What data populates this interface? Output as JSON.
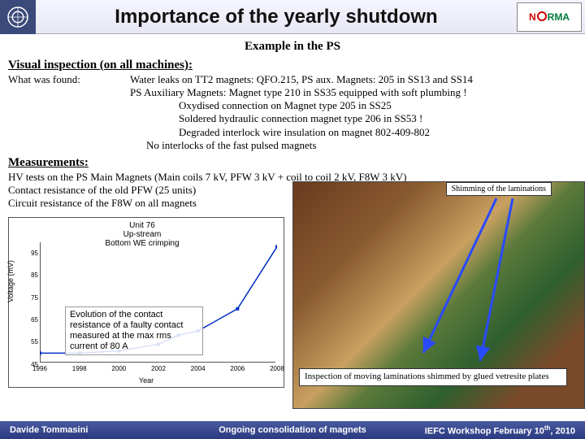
{
  "header": {
    "title": "Importance of the yearly shutdown",
    "right_logo_red": "N",
    "right_logo_green": "RMA"
  },
  "subtitle": "Example in the PS",
  "visual": {
    "heading": "Visual inspection (on all machines):",
    "found_label": "What was found:",
    "lines": [
      "Water leaks on TT2 magnets: QFO.215, PS aux. Magnets: 205 in SS13 and SS14",
      "PS Auxiliary Magnets: Magnet type 210 in SS35 equipped with soft plumbing !",
      "Oxydised connection on Magnet type 205 in SS25",
      "Soldered hydraulic connection magnet type 206 in SS53 !",
      "Degraded interlock wire insulation on magnet 802-409-802",
      "No interlocks of the fast pulsed magnets"
    ]
  },
  "measurements": {
    "heading": "Measurements:",
    "lines": [
      "HV tests on the PS Main Magnets (Main coils 7 kV, PFW 3 kV + coil to coil 2 kV, F8W 3 kV)",
      "Contact resistance of the old PFW (25 units)",
      "Circuit resistance of the F8W on all magnets"
    ]
  },
  "chart_data": {
    "type": "line",
    "title": "Unit 76\nUp-stream\nBottom WE crimping",
    "xlabel": "Year",
    "ylabel": "Voltage (mV)",
    "ylim": [
      45,
      100
    ],
    "x": [
      1996,
      1998,
      2000,
      2002,
      2003,
      2004,
      2006,
      2008
    ],
    "values": [
      50,
      50,
      51,
      54,
      58,
      60,
      70,
      98
    ]
  },
  "chart_note": "Evolution of the contact resistance of a faulty contact measured at the max rms current of 80 A",
  "shim_label": "Shimming of the laminations",
  "caption2": "Inspection of moving laminations shimmed by glued vetresite plates",
  "footer": {
    "left": "Davide Tommasini",
    "mid": "Ongoing consolidation of magnets",
    "right_a": "IEFC Workshop February 10",
    "right_sup": "th",
    "right_b": ", 2010"
  }
}
